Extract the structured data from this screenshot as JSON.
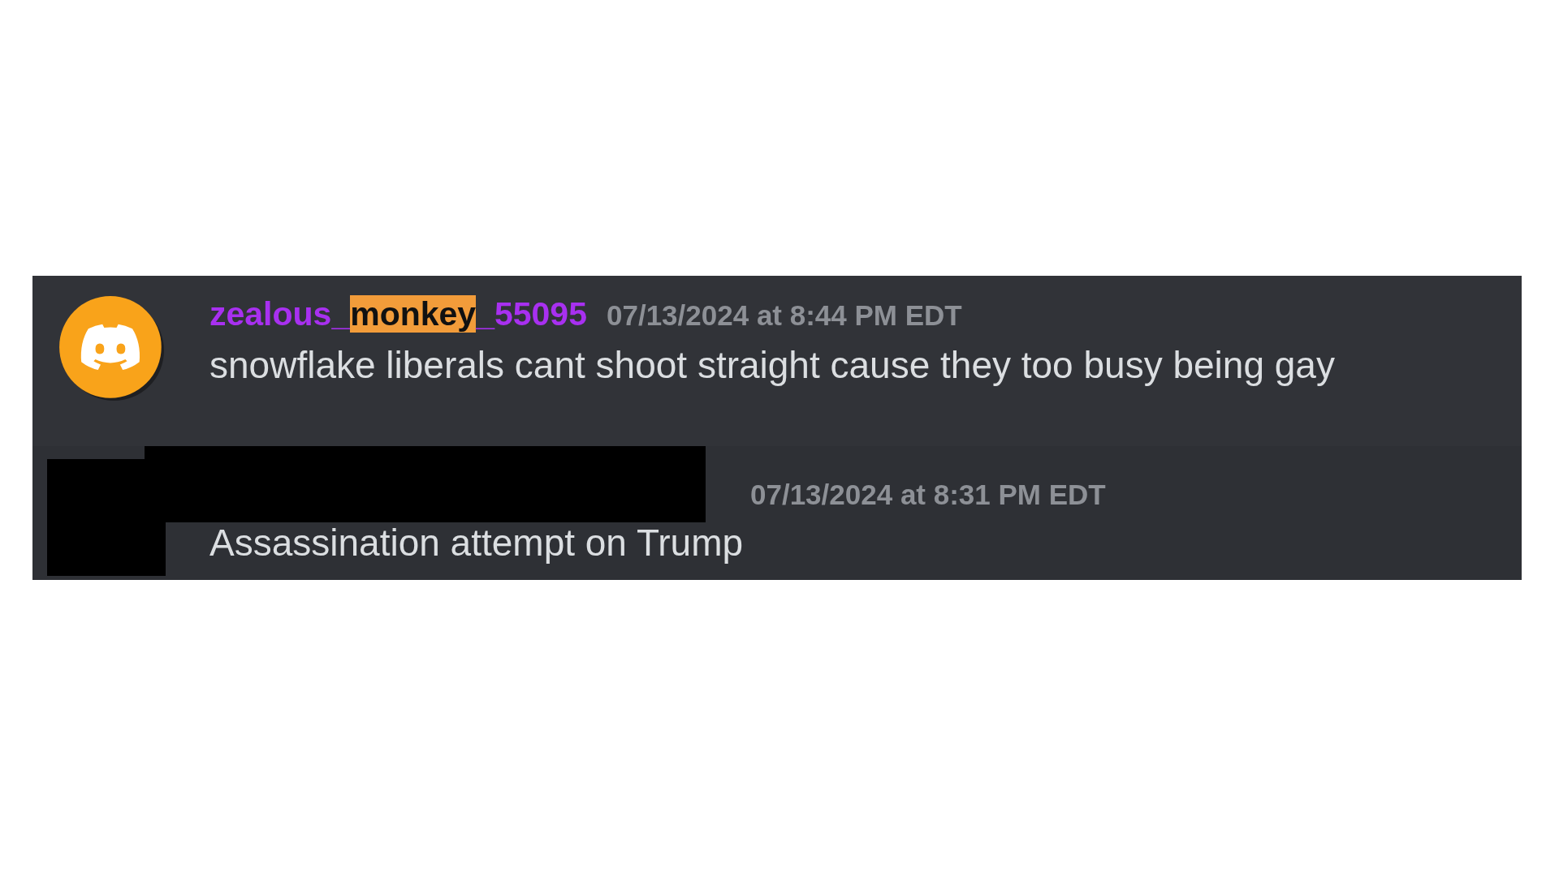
{
  "messages": [
    {
      "kind": "plain",
      "hovered": false,
      "username_parts": [
        {
          "text": "zealous_",
          "highlighted": false
        },
        {
          "text": "monkey",
          "highlighted": true
        },
        {
          "text": "_55095",
          "highlighted": false
        }
      ],
      "timestamp": "07/13/2024 at 8:44 PM EDT",
      "text": "snowflake liberals cant shoot straight cause they too busy being gay"
    },
    {
      "kind": "redacted",
      "hovered": true,
      "timestamp": "07/13/2024 at 8:31 PM EDT",
      "text": "Assassination attempt on Trump"
    }
  ]
}
